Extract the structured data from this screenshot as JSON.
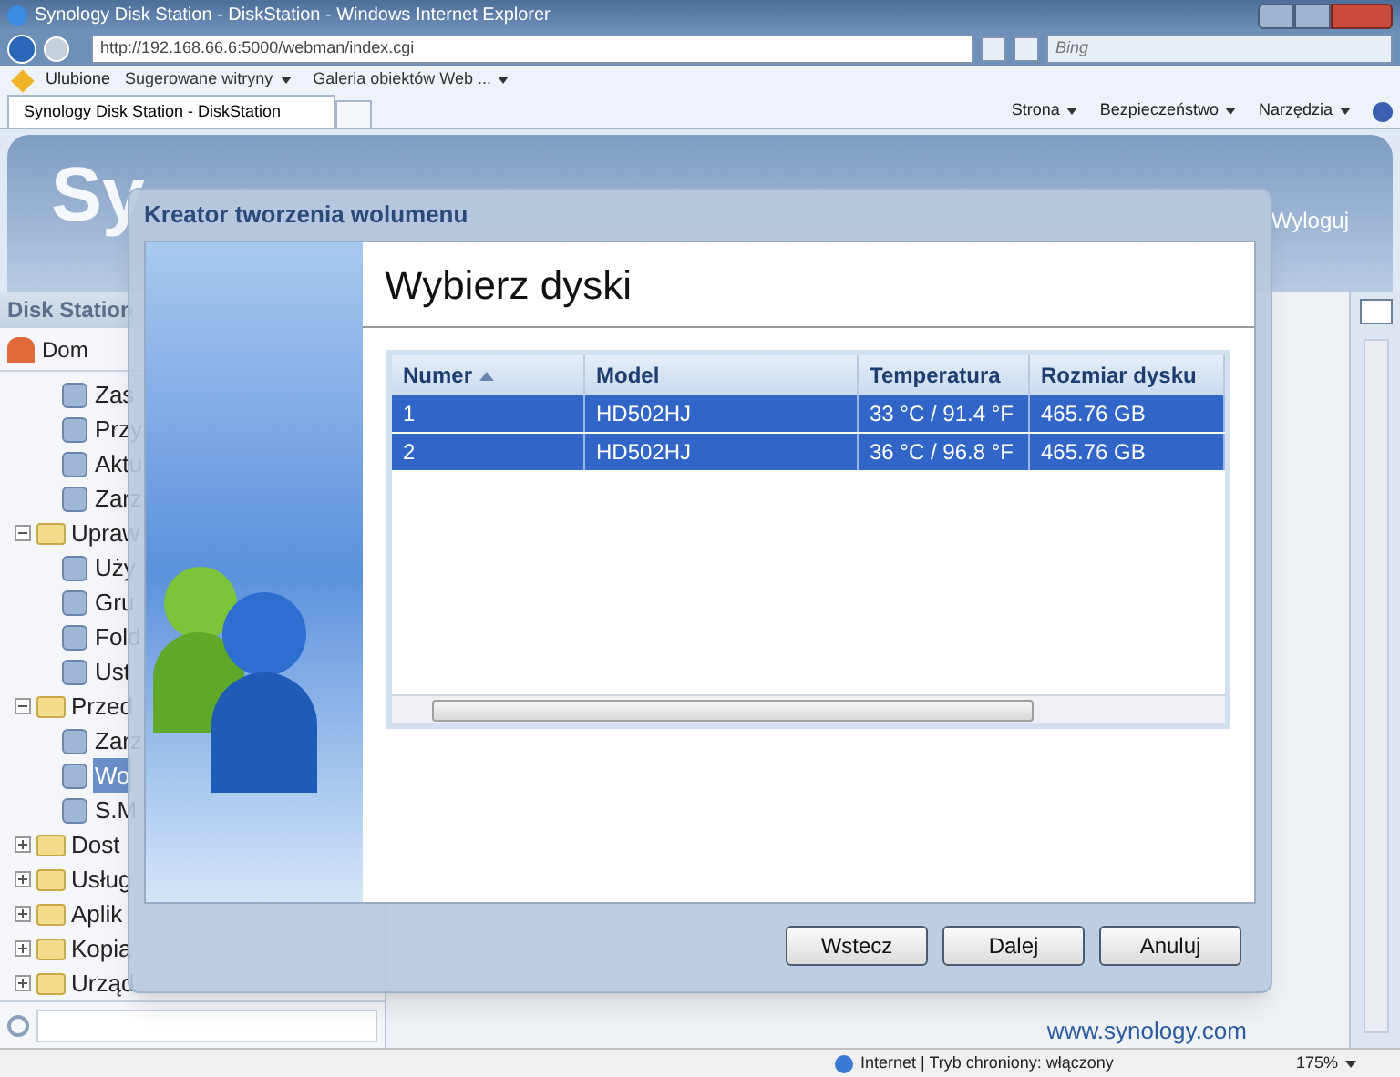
{
  "browser": {
    "title": "Synology Disk Station - DiskStation - Windows Internet Explorer",
    "address": "http://192.168.66.6:5000/webman/index.cgi",
    "search_placeholder": "Bing",
    "favorites_label": "Ulubione",
    "links": [
      "Sugerowane witryny",
      "Galeria obiektów Web ..."
    ],
    "tab": "Synology Disk Station - DiskStation",
    "commands": [
      "Strona",
      "Bezpieczeństwo",
      "Narzędzia"
    ]
  },
  "app": {
    "logo": "Sy",
    "logout": "Wyloguj",
    "panel_title": "Disk Station",
    "home": "Dom",
    "tree": [
      {
        "kind": "leaf",
        "label": "Zas",
        "selected": false
      },
      {
        "kind": "leaf",
        "label": "Przy",
        "selected": false
      },
      {
        "kind": "leaf",
        "label": "Aktu",
        "selected": false
      },
      {
        "kind": "leaf",
        "label": "Zarz",
        "selected": false
      },
      {
        "kind": "folder",
        "label": "Upraw",
        "expanded": true,
        "selected": false,
        "children": [
          {
            "kind": "leaf",
            "label": "Uży",
            "selected": false
          },
          {
            "kind": "leaf",
            "label": "Gru",
            "selected": false
          },
          {
            "kind": "leaf",
            "label": "Fold",
            "selected": false
          },
          {
            "kind": "leaf",
            "label": "Ust",
            "selected": false
          }
        ]
      },
      {
        "kind": "folder",
        "label": "Przed",
        "expanded": true,
        "selected": false,
        "children": [
          {
            "kind": "leaf",
            "label": "Zarz",
            "selected": false
          },
          {
            "kind": "leaf",
            "label": "Wo",
            "selected": true
          },
          {
            "kind": "leaf",
            "label": "S.M",
            "selected": false
          }
        ]
      },
      {
        "kind": "folder",
        "label": "Dost",
        "expanded": false,
        "selected": false
      },
      {
        "kind": "folder",
        "label": "Usług",
        "expanded": false,
        "selected": false
      },
      {
        "kind": "folder",
        "label": "Aplik",
        "expanded": false,
        "selected": false
      },
      {
        "kind": "folder",
        "label": "Kopia",
        "expanded": false,
        "selected": false
      },
      {
        "kind": "folder",
        "label": "Urząd",
        "expanded": false,
        "selected": false
      }
    ],
    "footer_link": "www.synology.com"
  },
  "dialog": {
    "title": "Kreator tworzenia wolumenu",
    "heading": "Wybierz dyski",
    "table": {
      "columns": [
        {
          "label": "Numer",
          "sorted": true
        },
        {
          "label": "Model",
          "sorted": false
        },
        {
          "label": "Temperatura",
          "sorted": false
        },
        {
          "label": "Rozmiar dysku",
          "sorted": false
        }
      ],
      "rows": [
        {
          "cells": [
            "1",
            "HD502HJ",
            "33 °C / 91.4 °F",
            "465.76 GB"
          ],
          "selected": true
        },
        {
          "cells": [
            "2",
            "HD502HJ",
            "36 °C / 96.8 °F",
            "465.76 GB"
          ],
          "selected": true
        }
      ]
    },
    "buttons": [
      "Wstecz",
      "Dalej",
      "Anuluj"
    ]
  },
  "status_bar": {
    "zone": "Internet | Tryb chroniony: włączony",
    "zoom": "175%"
  }
}
